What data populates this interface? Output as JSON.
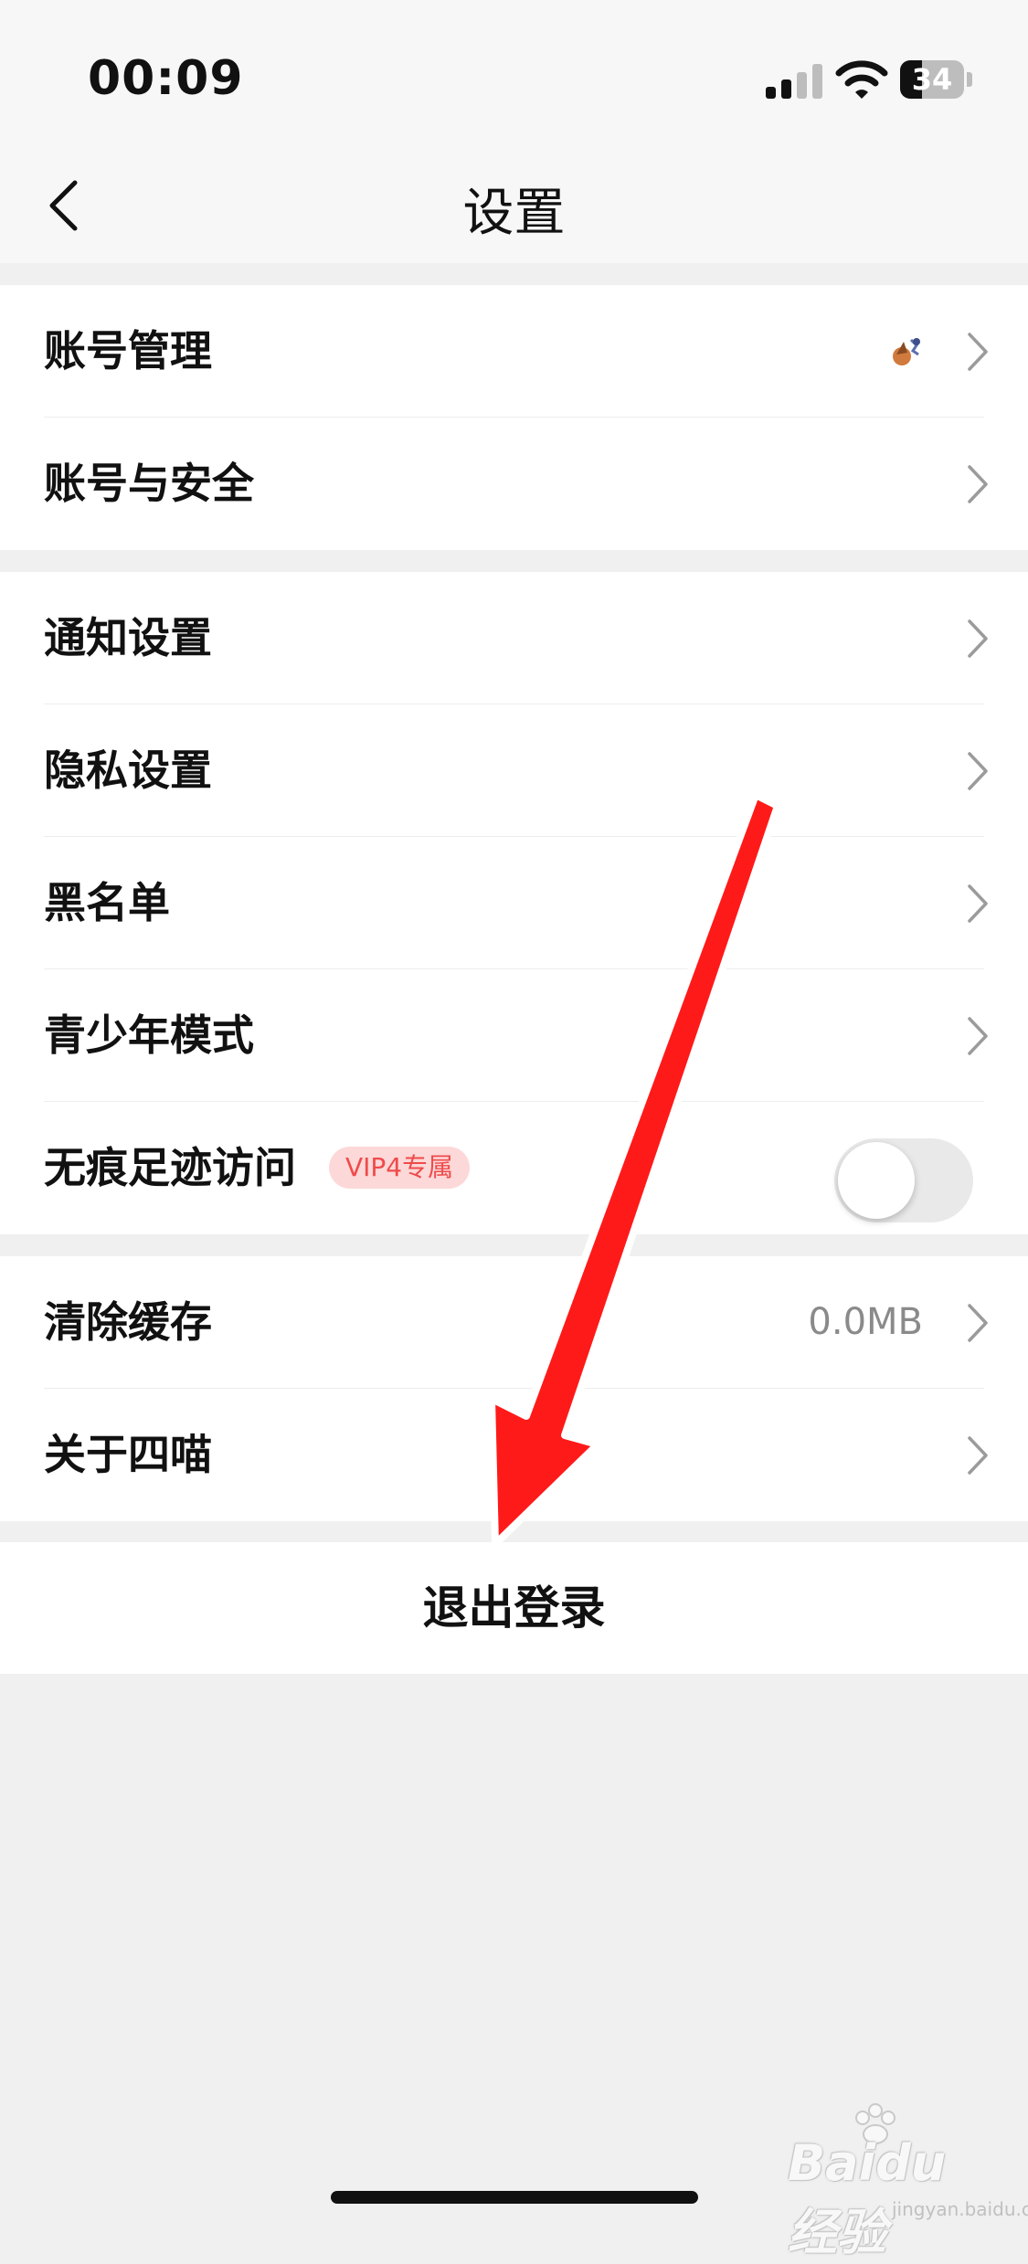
{
  "status_bar": {
    "time": "00:09",
    "battery_level": "34",
    "signal_bars_active": 2,
    "signal_bars_total": 4
  },
  "nav": {
    "title": "设置",
    "back_icon": "chevron-left-icon"
  },
  "groups": [
    {
      "items": [
        {
          "label": "账号管理",
          "has_avatar": true,
          "icon": "chevron-right-icon"
        },
        {
          "label": "账号与安全",
          "icon": "chevron-right-icon"
        }
      ]
    },
    {
      "items": [
        {
          "label": "通知设置",
          "icon": "chevron-right-icon"
        },
        {
          "label": "隐私设置",
          "icon": "chevron-right-icon"
        },
        {
          "label": "黑名单",
          "icon": "chevron-right-icon"
        },
        {
          "label": "青少年模式",
          "icon": "chevron-right-icon"
        },
        {
          "label": "无痕足迹访问",
          "badge": "VIP4专属",
          "toggle_on": false
        }
      ]
    },
    {
      "items": [
        {
          "label": "清除缓存",
          "value": "0.0MB",
          "icon": "chevron-right-icon"
        },
        {
          "label": "关于四喵",
          "icon": "chevron-right-icon"
        }
      ]
    }
  ],
  "logout": {
    "label": "退出登录"
  },
  "watermark": {
    "brand": "Baidu经验",
    "site": "jingyan.baidu.com"
  },
  "colors": {
    "background": "#f0f0f0",
    "surface": "#ffffff",
    "badge_bg": "#fdd8d8",
    "badge_text": "#ef4b4b",
    "annotation_arrow": "#ff1a1a"
  }
}
